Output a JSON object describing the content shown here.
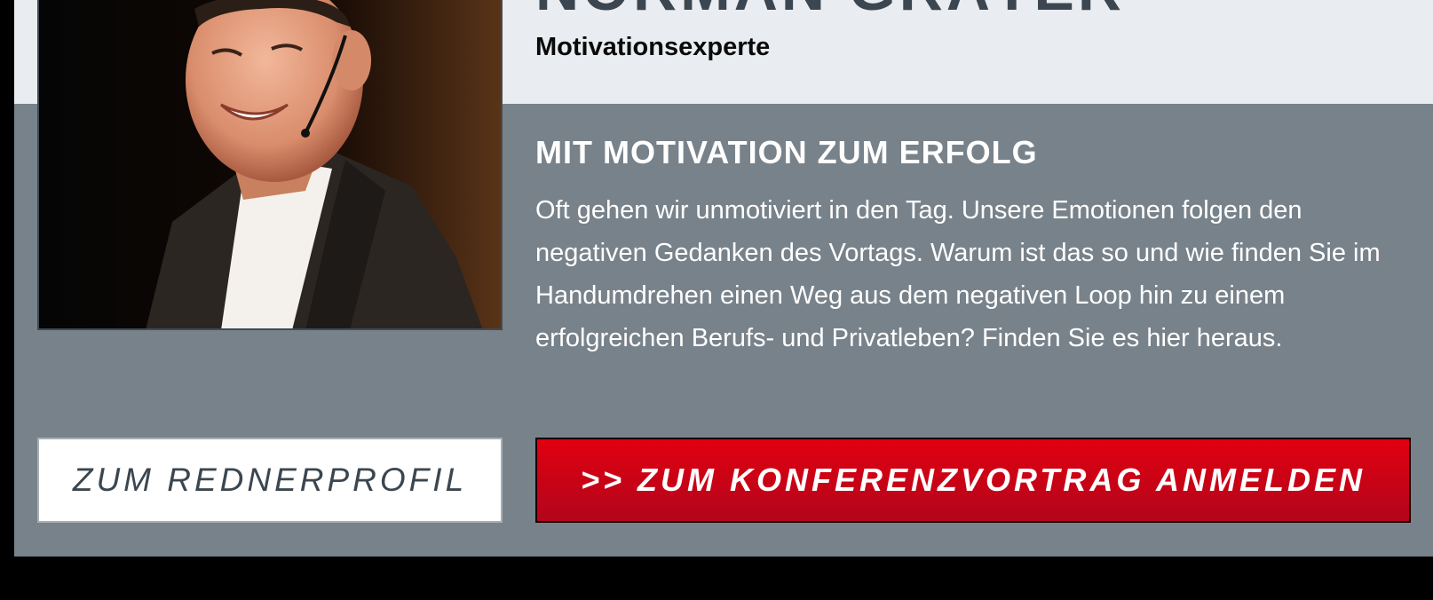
{
  "speaker": {
    "name": "NORMAN GRÄTER",
    "role": "Motivationsexperte"
  },
  "talk": {
    "title": "MIT MOTIVATION ZUM ERFOLG",
    "description": "Oft gehen wir unmotiviert in den Tag. Unsere Emotionen folgen den negativen Gedanken des Vortags. Warum ist das so und wie finden Sie im Handumdrehen einen Weg aus dem negativen Loop hin zu einem erfolgreichen Berufs- und Privatleben? Finden Sie es hier heraus."
  },
  "buttons": {
    "profile_label": "ZUM REDNERPROFIL",
    "register_label": ">> ZUM KONFERENZVORTRAG ANMELDEN"
  },
  "colors": {
    "background": "#000000",
    "top_band": "#e9ecf0",
    "main_band": "#78828a",
    "accent_red": "#d0000f",
    "dark_text": "#3b4650"
  }
}
